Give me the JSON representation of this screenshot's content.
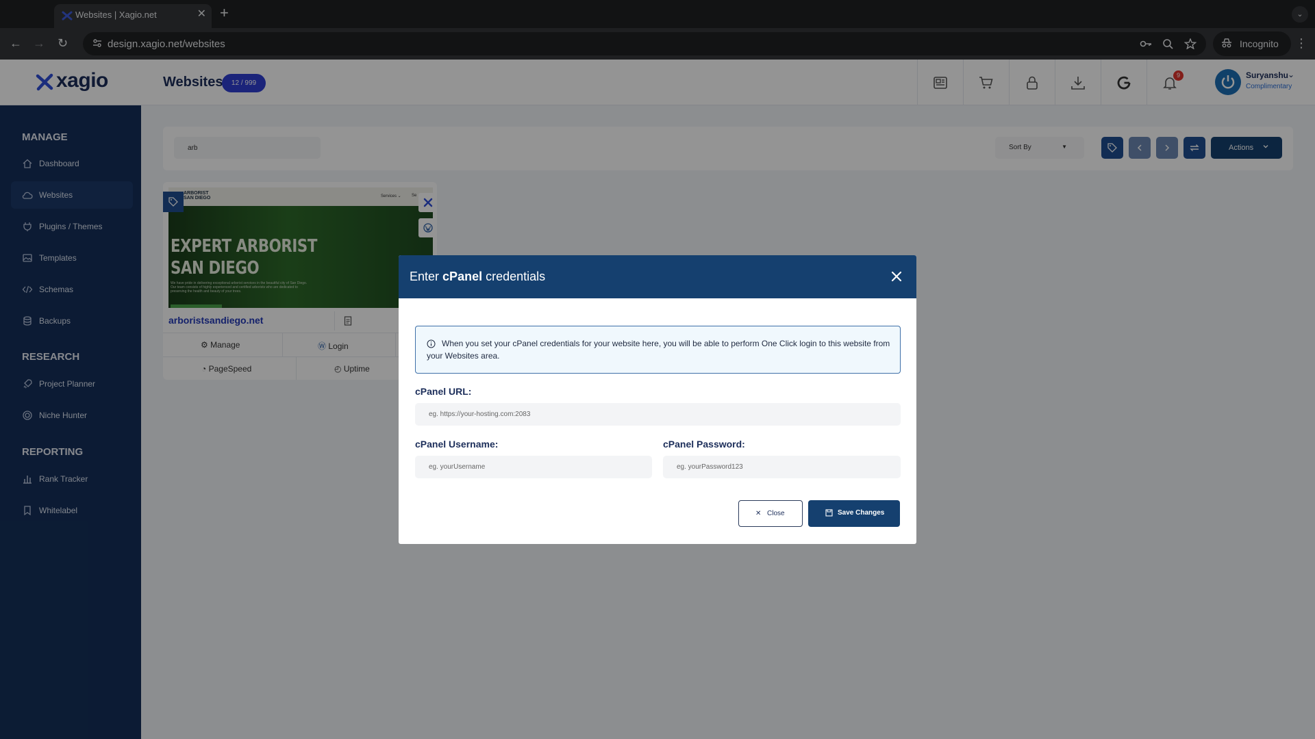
{
  "browser": {
    "tab_title": "Websites | Xagio.net",
    "url": "design.xagio.net/websites",
    "incognito_label": "Incognito"
  },
  "header": {
    "logo_text": "xagio",
    "page_title": "Websites",
    "count_badge": "12 / 999",
    "notification_count": "9",
    "user_name": "Suryanshu",
    "user_plan": "Complimentary",
    "icons": [
      "news-icon",
      "cart-icon",
      "lock-icon",
      "download-icon",
      "google-icon",
      "bell-icon"
    ]
  },
  "sidebar": {
    "sections": [
      {
        "title": "MANAGE",
        "items": [
          "Dashboard",
          "Websites",
          "Plugins / Themes",
          "Templates",
          "Schemas",
          "Backups"
        ]
      },
      {
        "title": "RESEARCH",
        "items": [
          "Project Planner",
          "Niche Hunter"
        ]
      },
      {
        "title": "REPORTING",
        "items": [
          "Rank Tracker",
          "Whitelabel"
        ]
      }
    ],
    "active_item": "Websites"
  },
  "filters": {
    "search_value": "arb",
    "sort_label": "Sort By",
    "actions_label": "Actions"
  },
  "site_card": {
    "brand_line1": "ARBORIST",
    "brand_line2": "SAN DIEGO",
    "nav_text": "Services ⌄",
    "nav_text2": "Se",
    "hero_line1": "EXPERT ARBORIST",
    "hero_line2": "SAN DIEGO",
    "hero_paragraph": "We have pride in delivering exceptional arborist services in the beautiful city of San Diego. Our team consists of highly experienced and certified arborists who are dedicated to preserving the health and beauty of your trees.",
    "domain": "arboristsandiego.net",
    "manage_label": "Manage",
    "login_label": "Login",
    "pagespeed_label": "PageSpeed",
    "uptime_label": "Uptime"
  },
  "modal": {
    "title_prefix": "Enter",
    "title_bold": "cPanel",
    "title_suffix": "credentials",
    "info_text": "When you set your cPanel credentials for your website here, you will be able to perform One Click login to this website from your Websites area.",
    "url_label": "cPanel URL:",
    "url_placeholder": "eg. https://your-hosting.com:2083",
    "username_label": "cPanel Username:",
    "username_placeholder": "eg. yourUsername",
    "password_label": "cPanel Password:",
    "password_placeholder": "eg. yourPassword123",
    "close_label": "Close",
    "save_label": "Save Changes"
  },
  "colors": {
    "sidebar_bg": "#15305a",
    "modal_header": "#15406f",
    "badge": "#2f3fd2",
    "notification": "#e0342e"
  }
}
